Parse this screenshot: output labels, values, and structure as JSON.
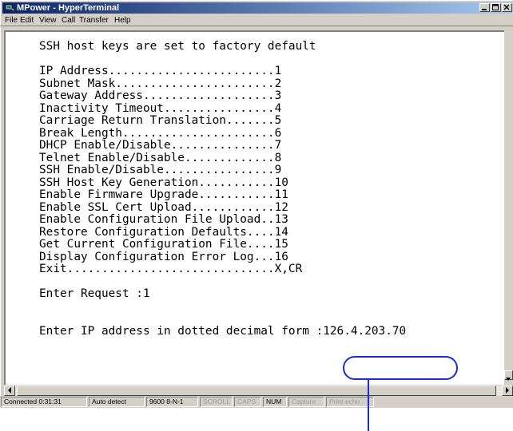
{
  "window": {
    "title": "MPower - HyperTerminal"
  },
  "menu": [
    "File",
    "Edit",
    "View",
    "Call",
    "Transfer",
    "Help"
  ],
  "terminal": {
    "lines": [
      "SSH host keys are set to factory default",
      "",
      "IP Address........................1",
      "Subnet Mask.......................2",
      "Gateway Address...................3",
      "Inactivity Timeout................4",
      "Carriage Return Translation.......5",
      "Break Length......................6",
      "DHCP Enable/Disable...............7",
      "Telnet Enable/Disable.............8",
      "SSH Enable/Disable................9",
      "SSH Host Key Generation...........10",
      "Enable Firmware Upgrade...........11",
      "Enable SSL Cert Upload............12",
      "Enable Configuration File Upload..13",
      "Restore Configuration Defaults....14",
      "Get Current Configuration File....15",
      "Display Configuration Error Log...16",
      "Exit..............................X,CR",
      "",
      "Enter Request :1",
      "",
      "",
      "Enter IP address in dotted decimal form :126.4.203.70"
    ]
  },
  "status": {
    "connected": "Connected 0:31:31",
    "detect": "Auto detect",
    "settings": "9600 8-N-1",
    "scroll": "SCROLL",
    "caps": "CAPS",
    "num": "NUM",
    "capture": "Capture",
    "print_echo": "Print echo"
  },
  "colors": {
    "callout": "#1a2bd8",
    "titlebar": "#0a246a"
  }
}
